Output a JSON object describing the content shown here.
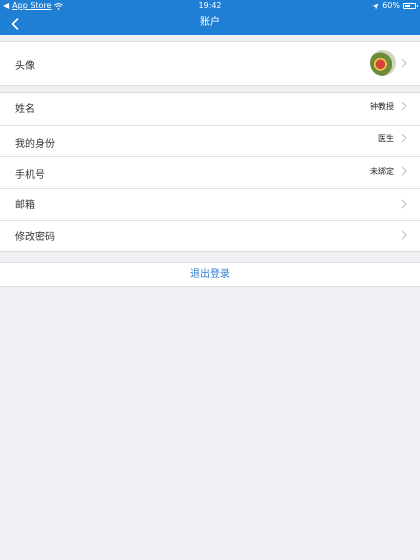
{
  "status_bar": {
    "back_app": "◀",
    "app_store": "App Store",
    "time": "19:42",
    "battery_percent": "60%",
    "battery_level": 0.6,
    "wifi_icon": "wifi-icon",
    "location_icon": "location-arrow-icon"
  },
  "navbar": {
    "title": "账户",
    "back_icon": "chevron-left-icon"
  },
  "avatar_row": {
    "label": "头像"
  },
  "profile_rows": [
    {
      "label": "姓名",
      "value": "钟教授"
    },
    {
      "label": "我的身份",
      "value": "医生"
    },
    {
      "label": "手机号",
      "value": "未绑定"
    },
    {
      "label": "邮箱",
      "value": ""
    },
    {
      "label": "修改密码",
      "value": ""
    }
  ],
  "logout": {
    "label": "退出登录"
  },
  "colors": {
    "header": "#1e7fd5",
    "background": "#efeff4",
    "logout_text": "#2d7fd2"
  }
}
